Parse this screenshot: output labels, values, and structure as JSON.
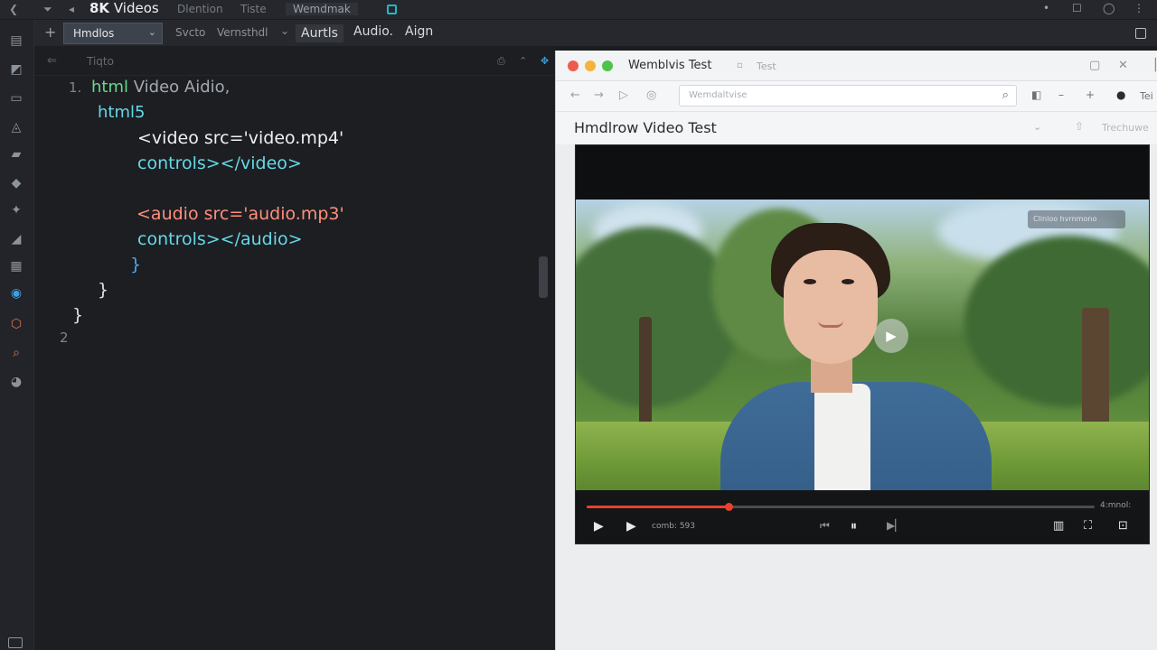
{
  "titlebar": {
    "nav_back": "❮",
    "nav_pin": "⏷",
    "nav_fwd": "◂",
    "app_title_strong": "8K",
    "app_title_rest": "Videos",
    "menu": [
      "Dlention",
      "Tiste",
      "Wemdmak"
    ],
    "window_controls": [
      "•",
      "☐",
      "◯",
      "⋮"
    ]
  },
  "activity_icons": [
    "files-icon",
    "search-icon",
    "git-icon",
    "debug-icon",
    "extensions-icon",
    "remote-icon",
    "testing-icon",
    "edit-icon",
    "layers-icon",
    "cloud-icon",
    "html-icon",
    "find-icon",
    "settings-icon"
  ],
  "toolbar": {
    "plus": "+",
    "select_value": "Hmdlos",
    "items": [
      "Svcto",
      "Vernsthdl"
    ],
    "chev": "⌄",
    "strong_items": [
      "Aurtls",
      "Audio.",
      "Aign"
    ]
  },
  "editor": {
    "back": "⇐",
    "title": "Tiqto",
    "actions": [
      "⎙",
      "⌃",
      "✥"
    ]
  },
  "code": {
    "line1_no": "1.",
    "line1_kw": "html",
    "line1_rest": "Video Aidio,",
    "line2_kw": "html5",
    "line3": "<video src='video.mp4'",
    "line4": "controls></video>",
    "line5": "<audio src='audio.mp3'",
    "line6": "controls></audio>",
    "brace1": "}",
    "brace2": "}",
    "brace3": "}",
    "line_no_2": "2"
  },
  "browser": {
    "tab_title": "Wemblvis Test",
    "tab_close": "▫",
    "tab2": "Test",
    "window_controls": [
      "▢",
      "✕",
      "▕"
    ],
    "nav": [
      "←",
      "→",
      "▷",
      "◎"
    ],
    "address_text": "Wemdaltvise",
    "search_icon": "⌕",
    "tools": [
      "◧",
      "–",
      "+",
      "●"
    ],
    "tool_text": "Tei",
    "page_title": "Hmdlrow Video Test",
    "page_chev": "⌄",
    "page_share": "⇧",
    "page_share_text": "Trechuwe"
  },
  "player": {
    "badge": "Clinloo hvrnmono",
    "progress": 0.28,
    "time_right": "4:mnol:",
    "time_left": "comb: 593",
    "play_overlay": "▶",
    "controls_left": [
      "▶",
      "▶"
    ],
    "controls_center": [
      "⏮",
      "⏸",
      "▶▏"
    ],
    "controls_right": [
      "▥",
      "⛶",
      "⊡"
    ]
  }
}
